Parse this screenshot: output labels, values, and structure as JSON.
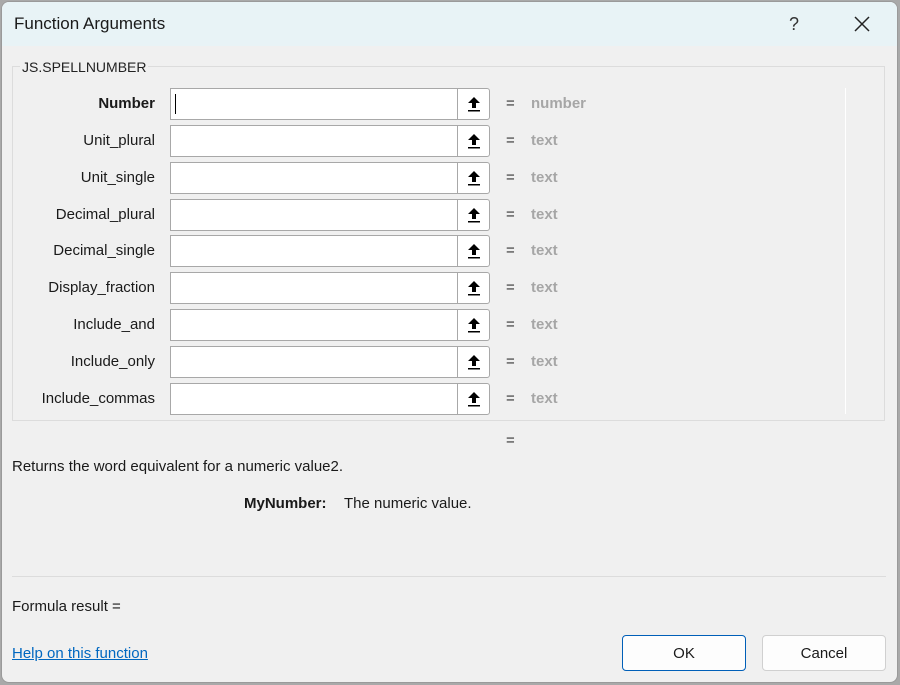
{
  "dialog": {
    "title": "Function Arguments",
    "help_label": "?",
    "close_icon": "close-icon"
  },
  "function": {
    "name": "JS.SPELLNUMBER",
    "arguments": [
      {
        "label": "Number",
        "value": "",
        "type_hint": "number",
        "bold": true,
        "focused": true
      },
      {
        "label": "Unit_plural",
        "value": "",
        "type_hint": "text",
        "bold": false
      },
      {
        "label": "Unit_single",
        "value": "",
        "type_hint": "text",
        "bold": false
      },
      {
        "label": "Decimal_plural",
        "value": "",
        "type_hint": "text",
        "bold": false
      },
      {
        "label": "Decimal_single",
        "value": "",
        "type_hint": "text",
        "bold": false
      },
      {
        "label": "Display_fraction",
        "value": "",
        "type_hint": "text",
        "bold": false
      },
      {
        "label": "Include_and",
        "value": "",
        "type_hint": "text",
        "bold": false
      },
      {
        "label": "Include_only",
        "value": "",
        "type_hint": "text",
        "bold": false
      },
      {
        "label": "Include_commas",
        "value": "",
        "type_hint": "text",
        "bold": false
      }
    ],
    "equals_sign": "=",
    "result_equals": "=",
    "description": "Returns the word equivalent for a numeric value2.",
    "arg_description_name": "MyNumber:",
    "arg_description_text": "The numeric value."
  },
  "footer": {
    "formula_result_label": "Formula result =",
    "help_link": "Help on this function",
    "ok_label": "OK",
    "cancel_label": "Cancel"
  },
  "colors": {
    "titlebar_bg": "#e8f3f6",
    "dialog_bg": "#f0f0f0",
    "type_hint": "#a6a6a6",
    "link": "#0067c0",
    "ok_border": "#005fb8"
  }
}
